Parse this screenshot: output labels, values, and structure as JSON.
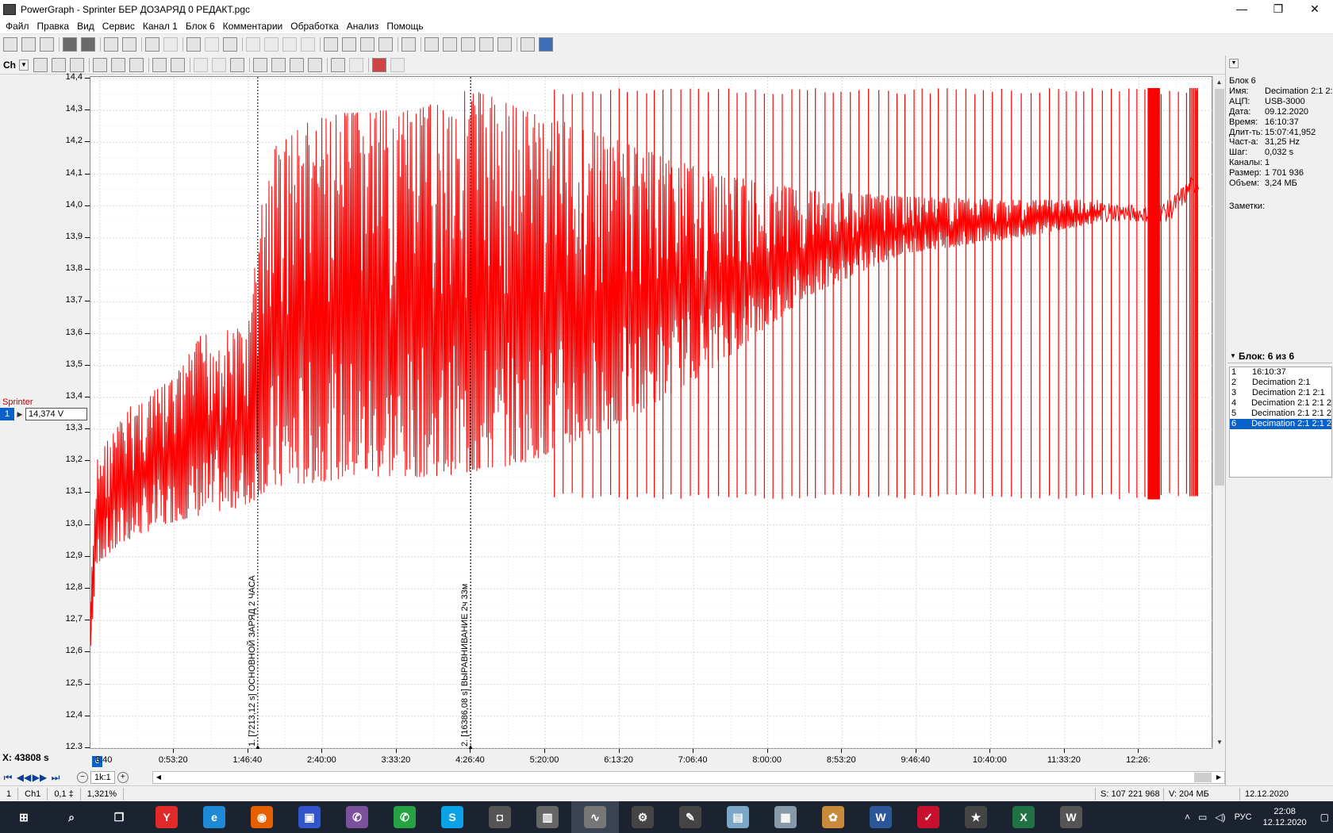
{
  "window": {
    "title": "PowerGraph - Sprinter БЕР ДОЗАРЯД 0 РЕДАКТ.pgc",
    "controls": [
      "—",
      "❐",
      "✕"
    ]
  },
  "menu": [
    "Файл",
    "Правка",
    "Вид",
    "Сервис",
    "Канал 1",
    "Блок 6",
    "Комментарии",
    "Обработка",
    "Анализ",
    "Помощь"
  ],
  "toolbar2": {
    "channel_select": "Ch"
  },
  "channel": {
    "name": "Sprinter",
    "number": "1",
    "cursor_value": "14,374 V",
    "color": "#ff0000"
  },
  "chart_data": {
    "type": "line",
    "title": "",
    "ylabel": "",
    "ylim": [
      12.3,
      14.4
    ],
    "yticks": [
      "14,4",
      "14,3",
      "14,2",
      "14,1",
      "14,0",
      "13,9",
      "13,8",
      "13,7",
      "13,6",
      "13,5",
      "13,4",
      "13,3",
      "13,2",
      "13,1",
      "13,0",
      "12,9",
      "12,8",
      "12,7",
      "12,6",
      "12,5",
      "12,4",
      "12,3"
    ],
    "xticks": [
      "0:53:20",
      "1:46:40",
      "2:40:00",
      "3:33:20",
      "4:26:40",
      "5:20:00",
      "6:13:20",
      "7:06:40",
      "8:00:00",
      "8:53:20",
      "9:46:40",
      "10:40:00",
      "11:33:20",
      "12:26:"
    ],
    "first_xtick": "6:40",
    "grid": true,
    "series": [
      {
        "name": "Sprinter",
        "color": "#ff0000",
        "envelope": [
          {
            "t": 0,
            "min": 12.62,
            "max": 12.78
          },
          {
            "t": 300,
            "min": 12.88,
            "max": 13.22
          },
          {
            "t": 1800,
            "min": 12.96,
            "max": 13.38
          },
          {
            "t": 3600,
            "min": 13.01,
            "max": 13.46
          },
          {
            "t": 4800,
            "min": 13.03,
            "max": 13.6
          },
          {
            "t": 6800,
            "min": 13.06,
            "max": 13.62
          },
          {
            "t": 7400,
            "min": 13.1,
            "max": 14.02
          },
          {
            "t": 8000,
            "min": 13.11,
            "max": 14.2
          },
          {
            "t": 9500,
            "min": 13.13,
            "max": 14.27
          },
          {
            "t": 11500,
            "min": 13.15,
            "max": 14.3
          },
          {
            "t": 14000,
            "min": 13.15,
            "max": 14.3
          },
          {
            "t": 16400,
            "min": 13.16,
            "max": 14.37
          },
          {
            "t": 19000,
            "min": 13.2,
            "max": 14.3
          },
          {
            "t": 23000,
            "min": 13.32,
            "max": 14.2
          },
          {
            "t": 27000,
            "min": 13.5,
            "max": 14.1
          },
          {
            "t": 31000,
            "min": 13.72,
            "max": 14.05
          },
          {
            "t": 35000,
            "min": 13.85,
            "max": 14.03
          },
          {
            "t": 40000,
            "min": 13.9,
            "max": 14.02
          },
          {
            "t": 43600,
            "min": 13.95,
            "max": 14.02
          },
          {
            "t": 45500,
            "min": 13.95,
            "max": 14.0
          },
          {
            "t": 46500,
            "min": 13.95,
            "max": 14.02
          },
          {
            "t": 47800,
            "min": 14.05,
            "max": 14.12
          }
        ],
        "spike_top": 14.37,
        "spike_bottom": 13.1
      }
    ],
    "markers": [
      {
        "t": 7213.12,
        "label": "1. [7213,12 s] ОСНОВНОЙ ЗАРЯД 2 ЧАСА"
      },
      {
        "t": 16386.08,
        "label": "2. [16386,08 s] ВЫРАВНИВАНИЕ 2ч 33м"
      }
    ],
    "xlim_seconds": [
      0,
      48400
    ]
  },
  "x_cursor": "X: 43808 s",
  "block_badge": "6",
  "nav": {
    "zoom_value": "1k:1"
  },
  "status": {
    "cells": [
      "1",
      "Ch1",
      "0,1 ‡",
      "1,321%"
    ],
    "samples": "S: 107 221 968",
    "volume": "V: 204 МБ",
    "date": "12.12.2020"
  },
  "block_info": [
    {
      "k": "Блок 6",
      "v": ""
    },
    {
      "k": "Имя:",
      "v": "Decimation 2:1 2:"
    },
    {
      "k": "АЦП:",
      "v": "USB-3000"
    },
    {
      "k": "Дата:",
      "v": "09.12.2020"
    },
    {
      "k": "Время:",
      "v": "16:10:37"
    },
    {
      "k": "Длит-ть:",
      "v": "15:07:41,952"
    },
    {
      "k": "Част-а:",
      "v": "31,25 Hz"
    },
    {
      "k": "Шаг:",
      "v": "0,032 s"
    },
    {
      "k": "Каналы:",
      "v": "1"
    },
    {
      "k": "Размер:",
      "v": "1 701 936"
    },
    {
      "k": "Объем:",
      "v": "3,24 МБ"
    }
  ],
  "notes_label": "Заметки:",
  "blocks": {
    "header": "Блок: 6 из 6",
    "items": [
      {
        "n": "1",
        "label": "16:10:37"
      },
      {
        "n": "2",
        "label": "Decimation 2:1"
      },
      {
        "n": "3",
        "label": "Decimation 2:1 2:1"
      },
      {
        "n": "4",
        "label": "Decimation 2:1 2:1 2"
      },
      {
        "n": "5",
        "label": "Decimation 2:1 2:1 2"
      },
      {
        "n": "6",
        "label": "Decimation 2:1 2:1 2"
      }
    ],
    "selected": 5
  },
  "taskbar": {
    "apps": [
      {
        "name": "start",
        "glyph": "⊞",
        "color": "#1b2330"
      },
      {
        "name": "search",
        "glyph": "⌕",
        "color": "#1b2330"
      },
      {
        "name": "taskview",
        "glyph": "❐",
        "color": "#1b2330"
      },
      {
        "name": "yandex-browser",
        "glyph": "Y",
        "color": "#e02a2a"
      },
      {
        "name": "internet-explorer",
        "glyph": "e",
        "color": "#1e8ad6"
      },
      {
        "name": "firefox",
        "glyph": "◉",
        "color": "#e66000"
      },
      {
        "name": "floppy-app",
        "glyph": "▣",
        "color": "#3355cc"
      },
      {
        "name": "viber",
        "glyph": "✆",
        "color": "#7b519d"
      },
      {
        "name": "whatsapp",
        "glyph": "✆",
        "color": "#25a244"
      },
      {
        "name": "skype",
        "glyph": "S",
        "color": "#0aa1e6"
      },
      {
        "name": "camera",
        "glyph": "◘",
        "color": "#555"
      },
      {
        "name": "chip-app",
        "glyph": "▥",
        "color": "#666"
      },
      {
        "name": "powergraph",
        "glyph": "∿",
        "color": "#777"
      },
      {
        "name": "tool-app",
        "glyph": "⚙",
        "color": "#444"
      },
      {
        "name": "pen-app",
        "glyph": "✎",
        "color": "#444"
      },
      {
        "name": "notepad-app",
        "glyph": "▤",
        "color": "#7aa7c7"
      },
      {
        "name": "calculator",
        "glyph": "▦",
        "color": "#8899aa"
      },
      {
        "name": "paint",
        "glyph": "✿",
        "color": "#c78b3a"
      },
      {
        "name": "word",
        "glyph": "W",
        "color": "#2b579a"
      },
      {
        "name": "pdf-app",
        "glyph": "✓",
        "color": "#c8102e"
      },
      {
        "name": "movie-app",
        "glyph": "★",
        "color": "#444"
      },
      {
        "name": "excel",
        "glyph": "X",
        "color": "#217346"
      },
      {
        "name": "w-app",
        "glyph": "W",
        "color": "#555"
      }
    ],
    "active_index": 12,
    "tray_lang": "РУС",
    "time": "22:08",
    "date": "12.12.2020"
  }
}
